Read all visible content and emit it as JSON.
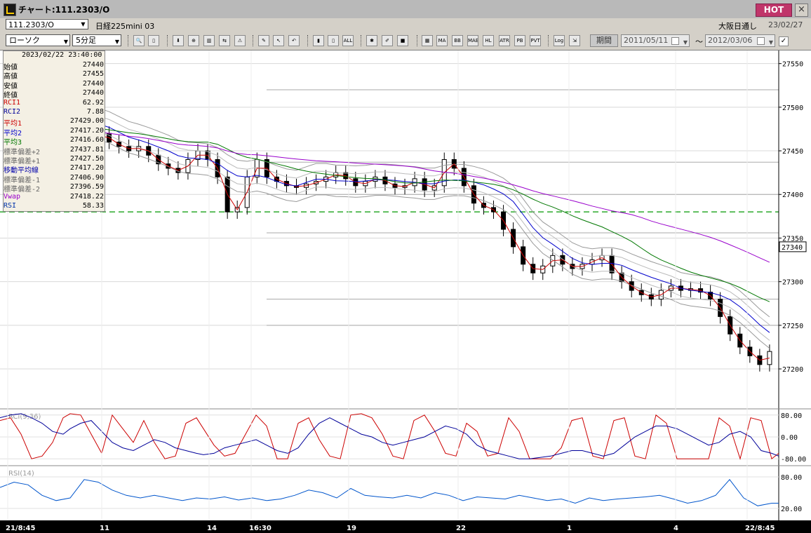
{
  "window": {
    "title": "チャート:111.2303/O",
    "hot_label": "HOT",
    "close_glyph": "×"
  },
  "header": {
    "symbol": "111.2303/O",
    "instrument": "日経225mini 03",
    "exchange": "大阪日通し",
    "date": "23/02/27"
  },
  "toolbar": {
    "chart_type": "ローソク",
    "interval": "5分足",
    "buttons": [
      {
        "name": "zoom-icon",
        "glyph": "🔍"
      },
      {
        "name": "bar-width-icon",
        "glyph": "▯"
      },
      {
        "name": "download-icon",
        "glyph": "⬇"
      },
      {
        "name": "magnify-plus-icon",
        "glyph": "⊕"
      },
      {
        "name": "chart-icon",
        "glyph": "▥"
      },
      {
        "name": "trend-icon",
        "glyph": "⇆"
      },
      {
        "name": "warning-icon",
        "glyph": "⚠"
      },
      {
        "name": "draw-line-icon",
        "glyph": "✎"
      },
      {
        "name": "cursor-icon",
        "glyph": "↖"
      },
      {
        "name": "undo-icon",
        "glyph": "↶"
      },
      {
        "name": "candle-icon",
        "glyph": "▮"
      },
      {
        "name": "candle-alt-icon",
        "glyph": "▯"
      },
      {
        "name": "all-label",
        "glyph": "ALL"
      },
      {
        "name": "gear-icon",
        "glyph": "✱"
      },
      {
        "name": "brush-icon",
        "glyph": "✐"
      },
      {
        "name": "color-icon",
        "glyph": "■"
      },
      {
        "name": "grid-icon",
        "glyph": "▦"
      },
      {
        "name": "ma-label",
        "glyph": "MA"
      },
      {
        "name": "bb-label",
        "glyph": "BB"
      },
      {
        "name": "mae-label",
        "glyph": "MAE"
      },
      {
        "name": "hl-label",
        "glyph": "HL"
      },
      {
        "name": "atr-label",
        "glyph": "ATR"
      },
      {
        "name": "pb-label",
        "glyph": "PB"
      },
      {
        "name": "pvt-label",
        "glyph": "PVT"
      },
      {
        "name": "log-label",
        "glyph": "Log"
      },
      {
        "name": "export-icon",
        "glyph": "⇲"
      }
    ],
    "period_label": "期間",
    "date_from": "2011/05/11",
    "tilde": "～",
    "date_to": "2012/03/06",
    "check": "✓"
  },
  "info_panel": {
    "timestamp": "2023/02/22 23:40:00",
    "rows": [
      {
        "label": "始値",
        "value": "27440",
        "color": "#000000"
      },
      {
        "label": "高値",
        "value": "27455",
        "color": "#000000"
      },
      {
        "label": "安値",
        "value": "27440",
        "color": "#000000"
      },
      {
        "label": "終値",
        "value": "27440",
        "color": "#000000"
      },
      {
        "label": "RCI1",
        "value": "62.92",
        "color": "#cc0000"
      },
      {
        "label": "RCI2",
        "value": "7.88",
        "color": "#000099"
      },
      {
        "label": "平均1",
        "value": "27429.00",
        "color": "#cc0000"
      },
      {
        "label": "平均2",
        "value": "27417.20",
        "color": "#0000cc"
      },
      {
        "label": "平均3",
        "value": "27416.60",
        "color": "#007700"
      },
      {
        "label": "標準偏差+2",
        "value": "27437.81",
        "color": "#666666"
      },
      {
        "label": "標準偏差+1",
        "value": "27427.50",
        "color": "#666666"
      },
      {
        "label": "移動平均線",
        "value": "27417.20",
        "color": "#0000aa"
      },
      {
        "label": "標準偏差-1",
        "value": "27406.90",
        "color": "#666666"
      },
      {
        "label": "標準偏差-2",
        "value": "27396.59",
        "color": "#666666"
      },
      {
        "label": "Vwap",
        "value": "27418.22",
        "color": "#9900cc"
      },
      {
        "label": "RSI",
        "value": "58.33",
        "color": "#0033aa"
      }
    ]
  },
  "chart_data": {
    "type": "candlestick",
    "price_axis": {
      "ticks": [
        27550,
        27500,
        27450,
        27400,
        27350,
        27300,
        27250,
        27200
      ],
      "range": [
        27155,
        27565
      ],
      "current_price": "27340",
      "dashed_level": 27380
    },
    "x_labels": [
      "21/8:45",
      "11",
      "14",
      "16:30",
      "19",
      "22",
      "1",
      "4",
      "22/8:45"
    ],
    "rci": {
      "label": "RCI(9,36)",
      "ticks": [
        "80.00",
        "0.00",
        "-80.00"
      ],
      "range": [
        -100,
        100
      ],
      "x": [
        0,
        15,
        30,
        45,
        60,
        75,
        90,
        100,
        115,
        130,
        145,
        160,
        175,
        190,
        205,
        220,
        235,
        250,
        265,
        280,
        290,
        305,
        320,
        335,
        350,
        365,
        380,
        395,
        410,
        425,
        440,
        455,
        470,
        485,
        500,
        515,
        530,
        545,
        560,
        575,
        590,
        605,
        620,
        635,
        650,
        665,
        680,
        695,
        710,
        725,
        740,
        755,
        770,
        785,
        800,
        815,
        830,
        845,
        860,
        875,
        890,
        905,
        920,
        935,
        950,
        965,
        980,
        995,
        1010,
        1025,
        1040,
        1055,
        1070,
        1085,
        1100,
        1110
      ],
      "series": [
        {
          "name": "RCI1",
          "color": "#cc0000",
          "values": [
            60,
            70,
            10,
            -80,
            -70,
            -20,
            70,
            85,
            80,
            10,
            -60,
            80,
            30,
            -20,
            60,
            -20,
            -80,
            -70,
            50,
            70,
            30,
            -30,
            -70,
            -60,
            10,
            80,
            40,
            -80,
            -80,
            50,
            70,
            -10,
            -70,
            -80,
            80,
            85,
            70,
            10,
            -70,
            -80,
            60,
            80,
            20,
            -60,
            -70,
            50,
            20,
            -70,
            -60,
            70,
            20,
            -80,
            -80,
            -80,
            -40,
            60,
            70,
            -70,
            -80,
            60,
            70,
            -70,
            -80,
            80,
            50,
            -80,
            -80,
            -80,
            -80,
            70,
            40,
            -80,
            70,
            60,
            -80,
            -60
          ]
        },
        {
          "name": "RCI2",
          "color": "#000099",
          "values": [
            70,
            80,
            85,
            70,
            50,
            20,
            10,
            30,
            50,
            60,
            20,
            -20,
            -40,
            -50,
            -30,
            -10,
            -20,
            -40,
            -50,
            -60,
            -65,
            -60,
            -40,
            -30,
            -20,
            -10,
            -30,
            -50,
            -60,
            -40,
            10,
            50,
            70,
            50,
            30,
            10,
            0,
            -20,
            -30,
            -20,
            -10,
            0,
            20,
            40,
            30,
            10,
            -30,
            -50,
            -60,
            -70,
            -80,
            -80,
            -75,
            -70,
            -60,
            -50,
            -50,
            -60,
            -70,
            -60,
            -30,
            0,
            20,
            40,
            40,
            30,
            10,
            -10,
            -30,
            -20,
            10,
            20,
            0,
            -50,
            -60,
            -70
          ]
        }
      ]
    },
    "rsi": {
      "label": "RSI(14)",
      "ticks": [
        "80.00",
        "20.00"
      ],
      "range": [
        0,
        100
      ],
      "x": [
        0,
        20,
        40,
        60,
        80,
        100,
        120,
        140,
        160,
        180,
        200,
        220,
        240,
        260,
        280,
        300,
        320,
        340,
        360,
        380,
        400,
        420,
        440,
        460,
        480,
        500,
        520,
        540,
        560,
        580,
        600,
        620,
        640,
        660,
        680,
        700,
        720,
        740,
        760,
        780,
        800,
        820,
        840,
        860,
        880,
        900,
        920,
        940,
        960,
        980,
        1000,
        1020,
        1040,
        1060,
        1080,
        1100,
        1110
      ],
      "values": [
        60,
        70,
        65,
        45,
        35,
        40,
        75,
        70,
        55,
        45,
        40,
        45,
        40,
        35,
        40,
        38,
        42,
        36,
        40,
        35,
        38,
        45,
        55,
        50,
        40,
        58,
        45,
        42,
        40,
        45,
        40,
        50,
        45,
        35,
        42,
        40,
        38,
        45,
        40,
        35,
        38,
        30,
        40,
        35,
        38,
        40,
        42,
        45,
        38,
        30,
        35,
        45,
        75,
        40,
        25,
        30,
        30
      ]
    },
    "candles_close": [
      27440,
      27470,
      27490,
      27500,
      27495,
      27480,
      27475,
      27470,
      27465,
      27470,
      27460,
      27455,
      27450,
      27455,
      27445,
      27435,
      27430,
      27425,
      27440,
      27450,
      27440,
      27420,
      27380,
      27385,
      27420,
      27440,
      27420,
      27415,
      27410,
      27408,
      27412,
      27415,
      27420,
      27425,
      27418,
      27410,
      27415,
      27420,
      27412,
      27408,
      27410,
      27418,
      27405,
      27410,
      27440,
      27430,
      27410,
      27390,
      27385,
      27380,
      27360,
      27340,
      27320,
      27310,
      27318,
      27330,
      27320,
      27315,
      27320,
      27325,
      27330,
      27310,
      27300,
      27290,
      27285,
      27280,
      27290,
      27295,
      27290,
      27292,
      27288,
      27280,
      27260,
      27240,
      27225,
      27215,
      27205,
      27220
    ],
    "ma_lines": [
      {
        "name": "平均1",
        "color": "#cc0000"
      },
      {
        "name": "平均2",
        "color": "#0000cc"
      },
      {
        "name": "平均3",
        "color": "#007700"
      },
      {
        "name": "Vwap",
        "color": "#9900cc"
      }
    ]
  }
}
